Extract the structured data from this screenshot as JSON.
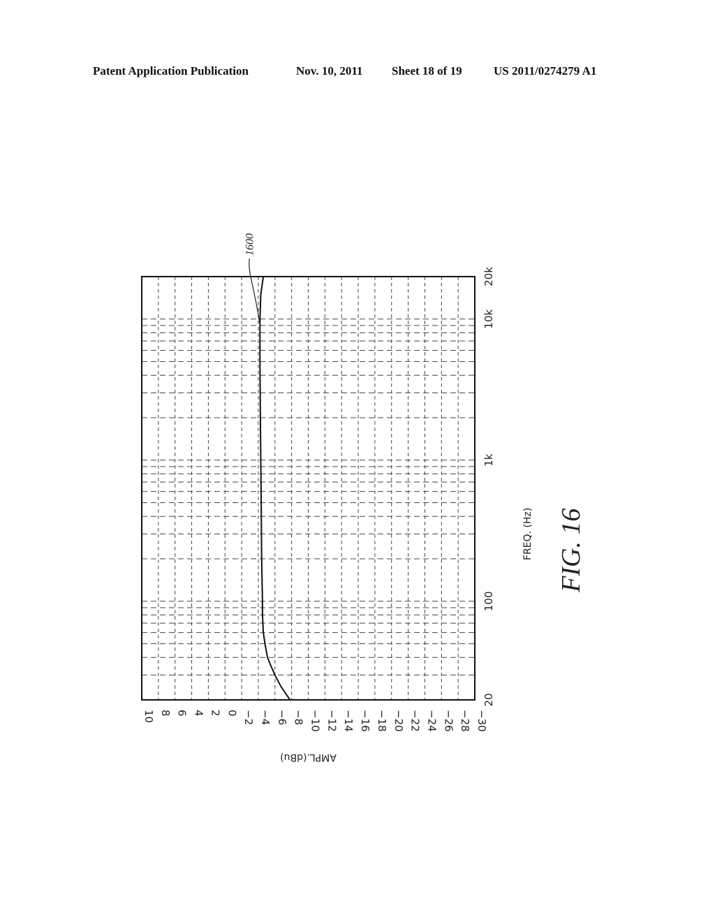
{
  "header": {
    "publication": "Patent Application Publication",
    "date": "Nov. 10, 2011",
    "sheet": "Sheet 18 of 19",
    "number": "US 2011/0274279 A1"
  },
  "figure": {
    "label": "FIG. 16",
    "reference_numeral": "1600"
  },
  "chart_data": {
    "type": "line",
    "orientation": "rotated-90-ccw",
    "title": "",
    "xlabel": "FREQ. (Hz)",
    "ylabel": "AMPL.(dBu)",
    "x_scale": "log",
    "xlim": [
      20,
      20000
    ],
    "ylim": [
      -30,
      10
    ],
    "x_ticks": [
      20,
      100,
      1000,
      10000,
      20000
    ],
    "x_tick_labels": [
      "20",
      "100",
      "1k",
      "10k",
      "20k"
    ],
    "y_ticks": [
      10,
      8,
      6,
      4,
      2,
      0,
      -2,
      -4,
      -6,
      -8,
      -10,
      -12,
      -14,
      -16,
      -18,
      -20,
      -22,
      -24,
      -26,
      -28,
      -30
    ],
    "y_tick_labels": [
      "10",
      "8",
      "6",
      "4",
      "2",
      "0",
      "-2",
      "-4",
      "-6",
      "-8",
      "-10",
      "-12",
      "-14",
      "-16",
      "-18",
      "-20",
      "-22",
      "-24",
      "-26",
      "-28",
      "-30"
    ],
    "grid": true,
    "series": [
      {
        "name": "1600",
        "x": [
          20,
          25,
          30,
          35,
          40,
          50,
          60,
          80,
          100,
          200,
          500,
          1000,
          2000,
          5000,
          10000,
          15000,
          20000
        ],
        "y": [
          -7.8,
          -6.7,
          -6.0,
          -5.5,
          -5.1,
          -4.8,
          -4.6,
          -4.5,
          -4.5,
          -4.4,
          -4.35,
          -4.3,
          -4.25,
          -4.2,
          -4.2,
          -4.3,
          -4.6
        ]
      }
    ]
  }
}
